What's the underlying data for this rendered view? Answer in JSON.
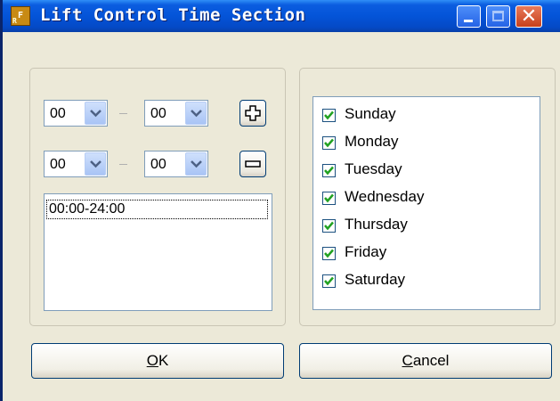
{
  "window": {
    "title": "Lift Control Time Section",
    "icon": "app-icon",
    "controls": [
      "minimize-icon",
      "maximize-icon",
      "close-icon"
    ]
  },
  "time_section": {
    "row1": {
      "start": "00",
      "end": "00",
      "button": "plus-icon"
    },
    "row2": {
      "start": "00",
      "end": "00",
      "button": "minus-icon"
    },
    "list": [
      "00:00-24:00"
    ]
  },
  "days": [
    {
      "label": "Sunday",
      "checked": true
    },
    {
      "label": "Monday",
      "checked": true
    },
    {
      "label": "Tuesday",
      "checked": true
    },
    {
      "label": "Wednesday",
      "checked": true
    },
    {
      "label": "Thursday",
      "checked": true
    },
    {
      "label": "Friday",
      "checked": true
    },
    {
      "label": "Saturday",
      "checked": true
    }
  ],
  "buttons": {
    "ok_mnemonic": "O",
    "ok_rest": "K",
    "cancel_mnemonic": "C",
    "cancel_rest": "ancel"
  },
  "colors": {
    "titlebar": "#0454d8",
    "check": "#21a121",
    "face": "#ece9d8"
  }
}
